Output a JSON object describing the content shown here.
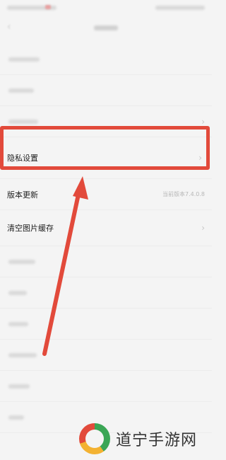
{
  "settings": {
    "privacy_label": "隐私设置",
    "update_label": "版本更新",
    "update_value": "当前版本7.4.0.8",
    "clear_cache_label": "清空图片缓存"
  },
  "watermark": {
    "text": "道宁手游网"
  },
  "icons": {
    "chevron": "›",
    "back": "‹"
  },
  "colors": {
    "highlight": "#e24a3b",
    "arrow": "#e24a3b"
  }
}
